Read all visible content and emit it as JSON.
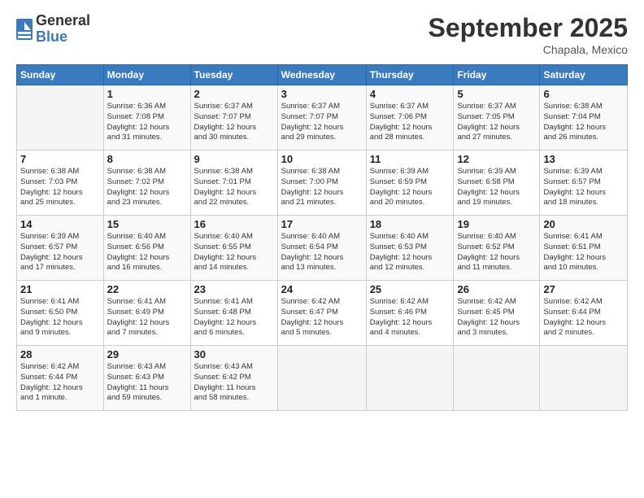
{
  "header": {
    "logo_general": "General",
    "logo_blue": "Blue",
    "month_title": "September 2025",
    "subtitle": "Chapala, Mexico"
  },
  "weekdays": [
    "Sunday",
    "Monday",
    "Tuesday",
    "Wednesday",
    "Thursday",
    "Friday",
    "Saturday"
  ],
  "weeks": [
    [
      {
        "day": "",
        "info": ""
      },
      {
        "day": "1",
        "info": "Sunrise: 6:36 AM\nSunset: 7:08 PM\nDaylight: 12 hours\nand 31 minutes."
      },
      {
        "day": "2",
        "info": "Sunrise: 6:37 AM\nSunset: 7:07 PM\nDaylight: 12 hours\nand 30 minutes."
      },
      {
        "day": "3",
        "info": "Sunrise: 6:37 AM\nSunset: 7:07 PM\nDaylight: 12 hours\nand 29 minutes."
      },
      {
        "day": "4",
        "info": "Sunrise: 6:37 AM\nSunset: 7:06 PM\nDaylight: 12 hours\nand 28 minutes."
      },
      {
        "day": "5",
        "info": "Sunrise: 6:37 AM\nSunset: 7:05 PM\nDaylight: 12 hours\nand 27 minutes."
      },
      {
        "day": "6",
        "info": "Sunrise: 6:38 AM\nSunset: 7:04 PM\nDaylight: 12 hours\nand 26 minutes."
      }
    ],
    [
      {
        "day": "7",
        "info": "Sunrise: 6:38 AM\nSunset: 7:03 PM\nDaylight: 12 hours\nand 25 minutes."
      },
      {
        "day": "8",
        "info": "Sunrise: 6:38 AM\nSunset: 7:02 PM\nDaylight: 12 hours\nand 23 minutes."
      },
      {
        "day": "9",
        "info": "Sunrise: 6:38 AM\nSunset: 7:01 PM\nDaylight: 12 hours\nand 22 minutes."
      },
      {
        "day": "10",
        "info": "Sunrise: 6:38 AM\nSunset: 7:00 PM\nDaylight: 12 hours\nand 21 minutes."
      },
      {
        "day": "11",
        "info": "Sunrise: 6:39 AM\nSunset: 6:59 PM\nDaylight: 12 hours\nand 20 minutes."
      },
      {
        "day": "12",
        "info": "Sunrise: 6:39 AM\nSunset: 6:58 PM\nDaylight: 12 hours\nand 19 minutes."
      },
      {
        "day": "13",
        "info": "Sunrise: 6:39 AM\nSunset: 6:57 PM\nDaylight: 12 hours\nand 18 minutes."
      }
    ],
    [
      {
        "day": "14",
        "info": "Sunrise: 6:39 AM\nSunset: 6:57 PM\nDaylight: 12 hours\nand 17 minutes."
      },
      {
        "day": "15",
        "info": "Sunrise: 6:40 AM\nSunset: 6:56 PM\nDaylight: 12 hours\nand 16 minutes."
      },
      {
        "day": "16",
        "info": "Sunrise: 6:40 AM\nSunset: 6:55 PM\nDaylight: 12 hours\nand 14 minutes."
      },
      {
        "day": "17",
        "info": "Sunrise: 6:40 AM\nSunset: 6:54 PM\nDaylight: 12 hours\nand 13 minutes."
      },
      {
        "day": "18",
        "info": "Sunrise: 6:40 AM\nSunset: 6:53 PM\nDaylight: 12 hours\nand 12 minutes."
      },
      {
        "day": "19",
        "info": "Sunrise: 6:40 AM\nSunset: 6:52 PM\nDaylight: 12 hours\nand 11 minutes."
      },
      {
        "day": "20",
        "info": "Sunrise: 6:41 AM\nSunset: 6:51 PM\nDaylight: 12 hours\nand 10 minutes."
      }
    ],
    [
      {
        "day": "21",
        "info": "Sunrise: 6:41 AM\nSunset: 6:50 PM\nDaylight: 12 hours\nand 9 minutes."
      },
      {
        "day": "22",
        "info": "Sunrise: 6:41 AM\nSunset: 6:49 PM\nDaylight: 12 hours\nand 7 minutes."
      },
      {
        "day": "23",
        "info": "Sunrise: 6:41 AM\nSunset: 6:48 PM\nDaylight: 12 hours\nand 6 minutes."
      },
      {
        "day": "24",
        "info": "Sunrise: 6:42 AM\nSunset: 6:47 PM\nDaylight: 12 hours\nand 5 minutes."
      },
      {
        "day": "25",
        "info": "Sunrise: 6:42 AM\nSunset: 6:46 PM\nDaylight: 12 hours\nand 4 minutes."
      },
      {
        "day": "26",
        "info": "Sunrise: 6:42 AM\nSunset: 6:45 PM\nDaylight: 12 hours\nand 3 minutes."
      },
      {
        "day": "27",
        "info": "Sunrise: 6:42 AM\nSunset: 6:44 PM\nDaylight: 12 hours\nand 2 minutes."
      }
    ],
    [
      {
        "day": "28",
        "info": "Sunrise: 6:42 AM\nSunset: 6:44 PM\nDaylight: 12 hours\nand 1 minute."
      },
      {
        "day": "29",
        "info": "Sunrise: 6:43 AM\nSunset: 6:43 PM\nDaylight: 11 hours\nand 59 minutes."
      },
      {
        "day": "30",
        "info": "Sunrise: 6:43 AM\nSunset: 6:42 PM\nDaylight: 11 hours\nand 58 minutes."
      },
      {
        "day": "",
        "info": ""
      },
      {
        "day": "",
        "info": ""
      },
      {
        "day": "",
        "info": ""
      },
      {
        "day": "",
        "info": ""
      }
    ]
  ]
}
